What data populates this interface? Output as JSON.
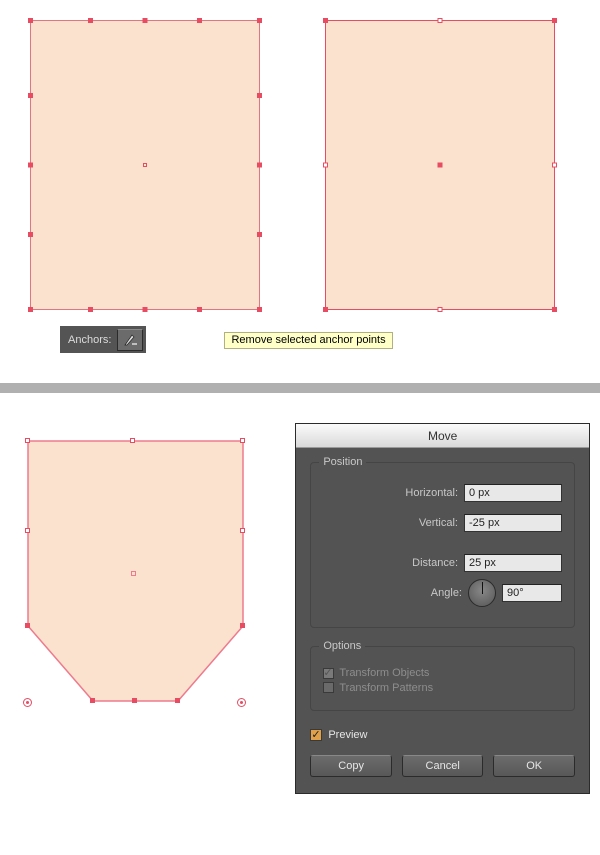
{
  "anchors_bar": {
    "label": "Anchors:"
  },
  "tooltip": {
    "text": "Remove selected anchor points"
  },
  "move_dialog": {
    "title": "Move",
    "position": {
      "legend": "Position",
      "horizontal_label": "Horizontal:",
      "horizontal_value": "0 px",
      "vertical_label": "Vertical:",
      "vertical_value": "-25 px",
      "distance_label": "Distance:",
      "distance_value": "25 px",
      "angle_label": "Angle:",
      "angle_value": "90°"
    },
    "options": {
      "legend": "Options",
      "transform_objects": "Transform Objects",
      "transform_patterns": "Transform Patterns"
    },
    "preview_label": "Preview",
    "buttons": {
      "copy": "Copy",
      "cancel": "Cancel",
      "ok": "OK"
    }
  }
}
